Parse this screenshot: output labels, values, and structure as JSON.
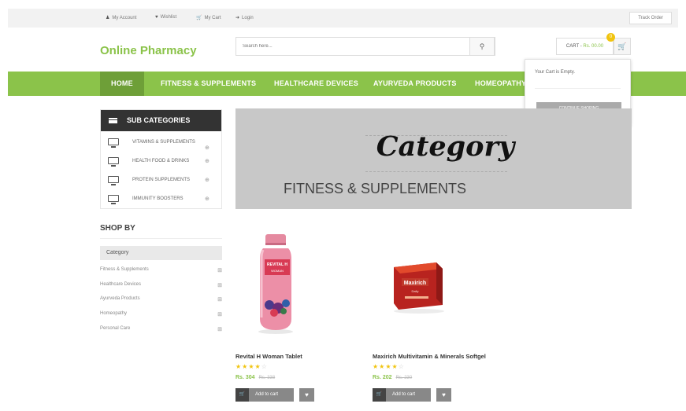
{
  "topbar": {
    "my_account": "My Account",
    "wishlist": "Wishlist",
    "my_cart": "My Cart",
    "login": "Login",
    "track_order": "Track Order"
  },
  "header": {
    "logo": "Online Pharmacy",
    "search_placeholder": "Search here...",
    "cart_label": "CART - ",
    "cart_amount": "Rs. 00.00",
    "cart_count": "0"
  },
  "nav": {
    "items": [
      "HOME",
      "FITNESS & SUPPLEMENTS",
      "HEALTHCARE DEVICES",
      "AYURVEDA PRODUCTS",
      "HOMEOPATHY"
    ]
  },
  "cart_dropdown": {
    "empty_text": "Your Cart is Empty.",
    "continue_label": "CONTINUE SHOPING"
  },
  "sidebar": {
    "title": "SUB CATEGORIES",
    "items": [
      "VITAMINS & SUPPLEMENTS",
      "HEALTH FOOD & DRINKS",
      "PROTEIN SUPPLEMENTS",
      "IMMUNITY BOOSTERS"
    ]
  },
  "shop_by": {
    "title": "SHOP BY",
    "filter_title": "Category",
    "items": [
      "Fitness & Supplements",
      "Healthcare Devices",
      "Ayurveda Products",
      "Homeopathy",
      "Personal Care"
    ]
  },
  "banner": {
    "title": "Category",
    "subtitle": "FITNESS & SUPPLEMENTS"
  },
  "products": [
    {
      "name": "Revital H Woman Tablet",
      "price": "Rs. 304",
      "old_price": "Rs. 338",
      "rating": 4,
      "add_label": "Add to cart"
    },
    {
      "name": "Maxirich Multivitamin & Minerals Softgel",
      "price": "Rs. 202",
      "old_price": "Rs. 230",
      "rating": 4,
      "add_label": "Add to cart"
    }
  ],
  "product_images": [
    {
      "brand": "REVITAL H",
      "sub": "WOMAN"
    },
    {
      "brand": "Maxirich",
      "sub": "Daily"
    }
  ],
  "colors": {
    "accent": "#8bc34a",
    "nav_active": "#6e9f38",
    "dark": "#333333",
    "star": "#f1c40f"
  },
  "icons": [
    "user-icon",
    "heart-icon",
    "cart-icon",
    "login-icon",
    "search-icon",
    "menu-icon",
    "monitor-icon",
    "plus-circle-icon"
  ]
}
